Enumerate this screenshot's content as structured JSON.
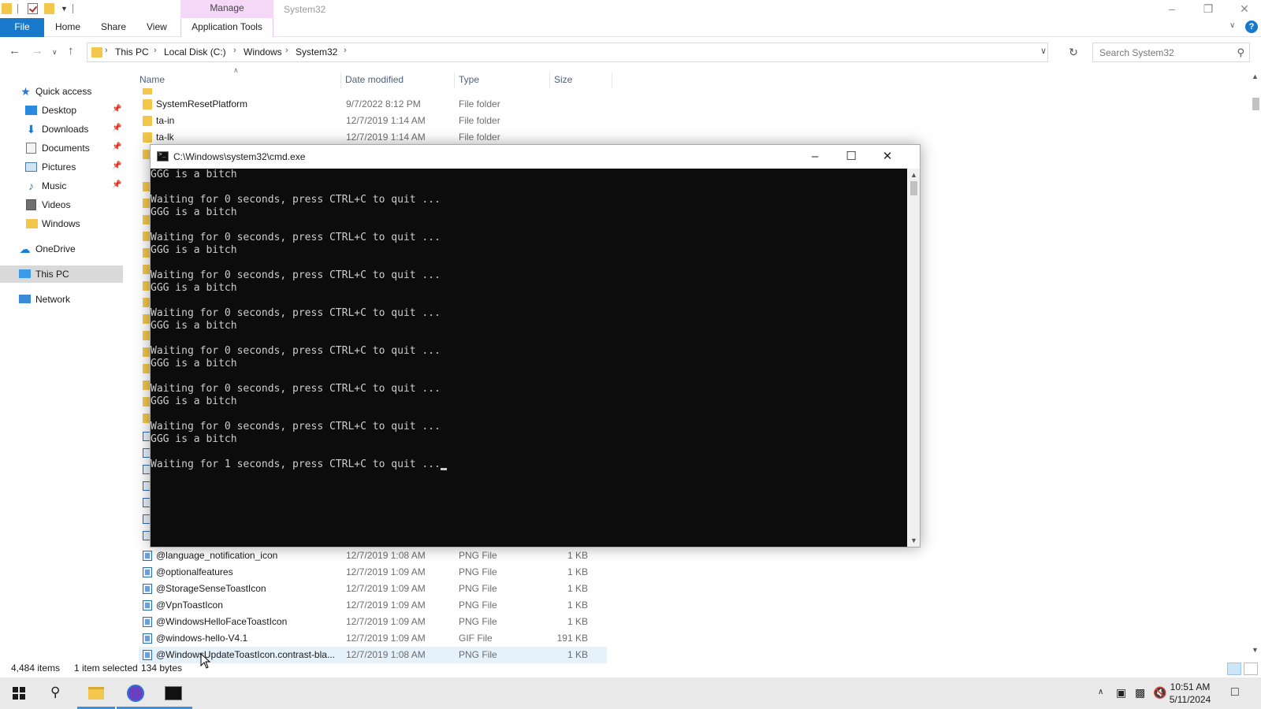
{
  "explorer": {
    "title": "System32",
    "manage_tab": "Manage",
    "ribbon_tabs": [
      "File",
      "Home",
      "Share",
      "View"
    ],
    "application_tools": "Application Tools",
    "breadcrumbs": [
      "This PC",
      "Local Disk (C:)",
      "Windows",
      "System32"
    ],
    "search_placeholder": "Search System32",
    "columns": [
      "Name",
      "Date modified",
      "Type",
      "Size"
    ],
    "top_rows": [
      {
        "name": "SystemResetPlatform",
        "date": "9/7/2022 8:12 PM",
        "type": "File folder",
        "size": ""
      },
      {
        "name": "ta-in",
        "date": "12/7/2019 1:14 AM",
        "type": "File folder",
        "size": ""
      },
      {
        "name": "ta-lk",
        "date": "12/7/2019 1:14 AM",
        "type": "File folder",
        "size": ""
      }
    ],
    "bottom_rows": [
      {
        "name": "@language_notification_icon",
        "date": "12/7/2019 1:08 AM",
        "type": "PNG File",
        "size": "1 KB"
      },
      {
        "name": "@optionalfeatures",
        "date": "12/7/2019 1:09 AM",
        "type": "PNG File",
        "size": "1 KB"
      },
      {
        "name": "@StorageSenseToastIcon",
        "date": "12/7/2019 1:09 AM",
        "type": "PNG File",
        "size": "1 KB"
      },
      {
        "name": "@VpnToastIcon",
        "date": "12/7/2019 1:09 AM",
        "type": "PNG File",
        "size": "1 KB"
      },
      {
        "name": "@WindowsHelloFaceToastIcon",
        "date": "12/7/2019 1:09 AM",
        "type": "PNG File",
        "size": "1 KB"
      },
      {
        "name": "@windows-hello-V4.1",
        "date": "12/7/2019 1:09 AM",
        "type": "GIF File",
        "size": "191 KB"
      },
      {
        "name": "@WindowsUpdateToastIcon.contrast-bla...",
        "date": "12/7/2019 1:08 AM",
        "type": "PNG File",
        "size": "1 KB"
      }
    ],
    "nav": {
      "quick_access": "Quick access",
      "items": [
        "Desktop",
        "Downloads",
        "Documents",
        "Pictures",
        "Music",
        "Videos",
        "Windows"
      ],
      "onedrive": "OneDrive",
      "this_pc": "This PC",
      "network": "Network"
    },
    "status": {
      "item_count": "4,484 items",
      "selected": "1 item selected",
      "selected_size": "134 bytes"
    }
  },
  "cmd": {
    "title": "C:\\Windows\\system32\\cmd.exe",
    "lines": [
      "GGG is a bitch",
      "",
      "Waiting for 0 seconds, press CTRL+C to quit ...",
      "GGG is a bitch",
      "",
      "Waiting for 0 seconds, press CTRL+C to quit ...",
      "GGG is a bitch",
      "",
      "Waiting for 0 seconds, press CTRL+C to quit ...",
      "GGG is a bitch",
      "",
      "Waiting for 0 seconds, press CTRL+C to quit ...",
      "GGG is a bitch",
      "",
      "Waiting for 0 seconds, press CTRL+C to quit ...",
      "GGG is a bitch",
      "",
      "Waiting for 0 seconds, press CTRL+C to quit ...",
      "GGG is a bitch",
      "",
      "Waiting for 0 seconds, press CTRL+C to quit ...",
      "GGG is a bitch",
      "",
      "Waiting for 1 seconds, press CTRL+C to quit ..."
    ]
  },
  "taskbar": {
    "time": "10:51 AM",
    "date": "5/11/2024"
  },
  "colors": {
    "accent": "#1979ca",
    "manage_tab": "#f5d7f8",
    "console_bg": "#0c0c0c",
    "console_text": "#cccccc"
  }
}
